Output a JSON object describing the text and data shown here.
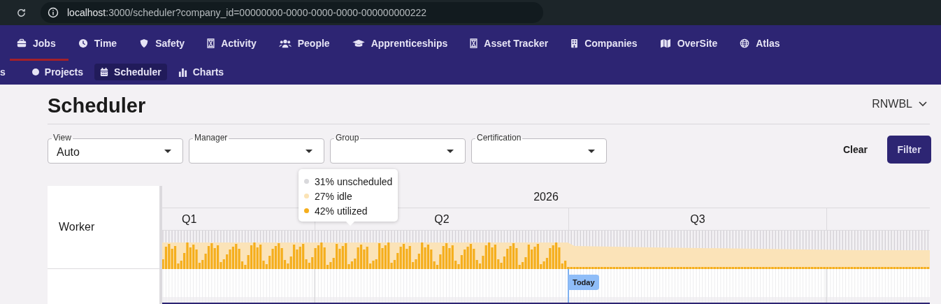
{
  "browser": {
    "url_host": "localhost",
    "url_rest": ":3000/scheduler?company_id=00000000-0000-0000-0000-000000000222"
  },
  "nav": [
    {
      "label": "Jobs",
      "selected": true
    },
    {
      "label": "Time",
      "selected": false
    },
    {
      "label": "Safety",
      "selected": false
    },
    {
      "label": "Activity",
      "selected": false
    },
    {
      "label": "People",
      "selected": false
    },
    {
      "label": "Apprenticeships",
      "selected": false
    },
    {
      "label": "Asset Tracker",
      "selected": false
    },
    {
      "label": "Companies",
      "selected": false
    },
    {
      "label": "OverSite",
      "selected": false
    },
    {
      "label": "Atlas",
      "selected": false
    }
  ],
  "subnav": [
    {
      "label": "s",
      "selected": false
    },
    {
      "label": "Projects",
      "selected": false
    },
    {
      "label": "Scheduler",
      "selected": true
    },
    {
      "label": "Charts",
      "selected": false
    }
  ],
  "page": {
    "title": "Scheduler",
    "company": "RNWBL"
  },
  "filters": [
    {
      "label": "View",
      "value": "Auto"
    },
    {
      "label": "Manager"
    },
    {
      "label": "Group"
    },
    {
      "label": "Certification"
    }
  ],
  "actions": {
    "clear": "Clear",
    "filter": "Filter"
  },
  "timeline": {
    "row_label": "Worker",
    "year": "2026",
    "quarters": [
      "Q1",
      "Q2",
      "Q3"
    ],
    "today": "Today"
  },
  "tooltip": [
    {
      "text": "31% unscheduled",
      "color": "#d9d9dc"
    },
    {
      "text": "27% idle",
      "color": "#fbe3b5"
    },
    {
      "text": "42% utilized",
      "color": "#f5ae1c"
    }
  ]
}
